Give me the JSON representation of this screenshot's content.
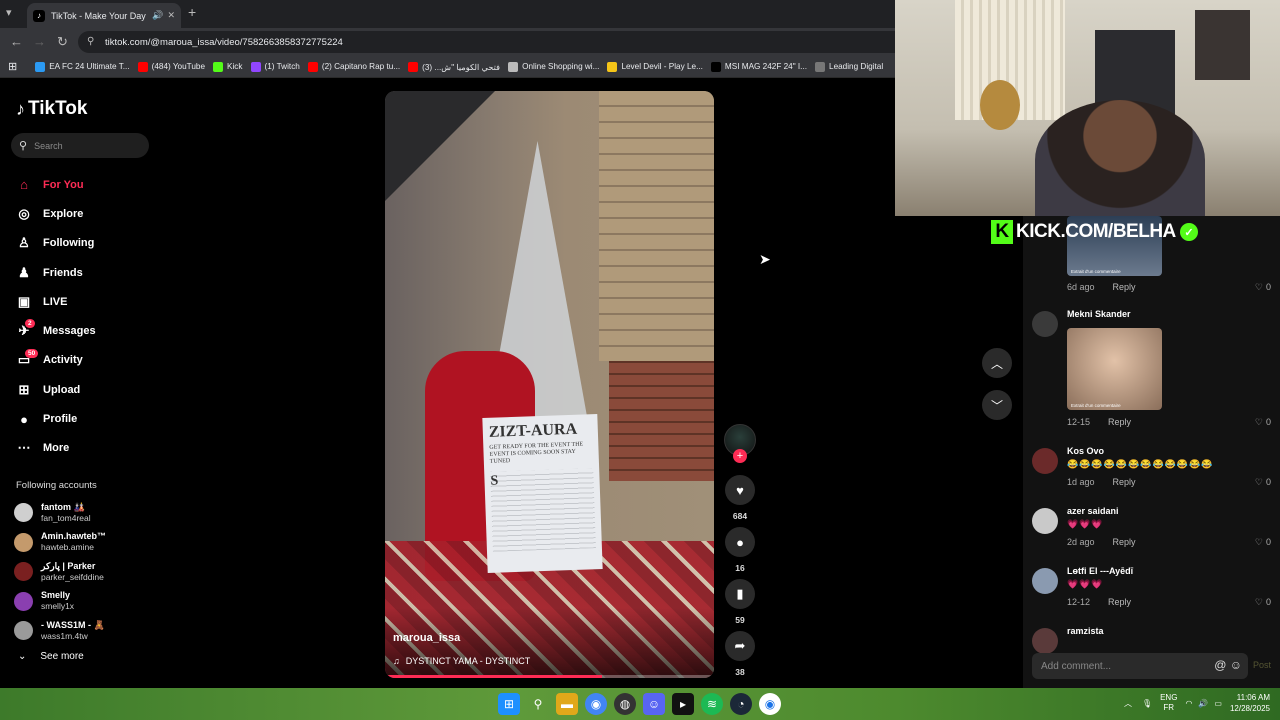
{
  "browser": {
    "tab_title": "TikTok - Make Your Day",
    "url": "tiktok.com/@maroua_issa/video/7582663858372775224",
    "bookmarks": [
      {
        "label": "EA FC 24 Ultimate T...",
        "color": "#2b9af3"
      },
      {
        "label": "(484) YouTube",
        "color": "#ff0000"
      },
      {
        "label": "Kick",
        "color": "#53fc18"
      },
      {
        "label": "(1) Twitch",
        "color": "#9146ff"
      },
      {
        "label": "(2) Capitano Rap tu...",
        "color": "#ff0000"
      },
      {
        "label": "فتحي الكوميا \"ش... (3)",
        "color": "#ff0000"
      },
      {
        "label": "Online Shopping wi...",
        "color": "#bbbbbb"
      },
      {
        "label": "Level Devil - Play Le...",
        "color": "#f5c518"
      },
      {
        "label": "MSI MAG 242F 24\" I...",
        "color": "#000000"
      },
      {
        "label": "Leading Digital",
        "color": "#777777"
      }
    ]
  },
  "tiktok": {
    "logo": "TikTok",
    "search_placeholder": "Search",
    "nav": [
      {
        "label": "For You",
        "icon": "home-icon",
        "glyph": "⌂",
        "active": true,
        "badge": ""
      },
      {
        "label": "Explore",
        "icon": "compass-icon",
        "glyph": "◎",
        "active": false,
        "badge": ""
      },
      {
        "label": "Following",
        "icon": "following-icon",
        "glyph": "♙",
        "active": false,
        "badge": ""
      },
      {
        "label": "Friends",
        "icon": "friends-icon",
        "glyph": "♟",
        "active": false,
        "badge": ""
      },
      {
        "label": "LIVE",
        "icon": "live-icon",
        "glyph": "▣",
        "active": false,
        "badge": ""
      },
      {
        "label": "Messages",
        "icon": "messages-icon",
        "glyph": "✈",
        "active": false,
        "badge": "2"
      },
      {
        "label": "Activity",
        "icon": "activity-icon",
        "glyph": "▭",
        "active": false,
        "badge": "50"
      },
      {
        "label": "Upload",
        "icon": "upload-icon",
        "glyph": "⊞",
        "active": false,
        "badge": ""
      },
      {
        "label": "Profile",
        "icon": "profile-icon",
        "glyph": "●",
        "active": false,
        "badge": ""
      },
      {
        "label": "More",
        "icon": "more-icon",
        "glyph": "⋯",
        "active": false,
        "badge": ""
      }
    ],
    "following_title": "Following accounts",
    "following": [
      {
        "name": "fantom 🎎",
        "handle": "fan_tom4real",
        "color": "#cfcfcf"
      },
      {
        "name": "Amin.hawteb™",
        "handle": "hawteb.amine",
        "color": "#c49a6c"
      },
      {
        "name": "پارکر | Parker",
        "handle": "parker_seifddine",
        "color": "#7a2020"
      },
      {
        "name": "Smelly",
        "handle": "smelly1x",
        "color": "#8a3fb0"
      },
      {
        "name": "- WASS1M - 🧸",
        "handle": "wass1m.4tw",
        "color": "#9a9a9a"
      }
    ],
    "see_more": "See more"
  },
  "video": {
    "username": "maroua_issa",
    "music": "DYSTINCT YAMA - DYSTINCT",
    "poster_heading": "ZIZT-AURA",
    "poster_text": "GET READY FOR THE EVENT THE EVENT IS COMING SOON STAY TUNED",
    "poster_letter": "S",
    "progress_fraction": 0.66,
    "likes": "684",
    "comments": "16",
    "saves": "59",
    "shares": "38"
  },
  "comments": [
    {
      "name": "",
      "text": "",
      "time": "6d ago",
      "likes": "0",
      "avatar": "",
      "has_thumb": true,
      "thumb_caption": "Extrait d'un commentaire"
    },
    {
      "name": "Mekni Skander",
      "text": "",
      "time": "12-15",
      "likes": "0",
      "avatar": "#3a3a3a",
      "has_thumb": true,
      "thumb_caption": "Extrait d'un commentaire"
    },
    {
      "name": "Kos Ovo",
      "text": "😂😂😂😂😂😂😂😂😂😂😂😂",
      "time": "1d ago",
      "likes": "0",
      "avatar": "#6b2a2a",
      "has_thumb": false
    },
    {
      "name": "azer saidani",
      "text": "💗💗💗",
      "time": "2d ago",
      "likes": "0",
      "avatar": "#c9c9c9",
      "has_thumb": false
    },
    {
      "name": "Lɵtfi El ---Ayēdī",
      "text": "💗💗💗",
      "time": "12-12",
      "likes": "0",
      "avatar": "#8a9ab0",
      "has_thumb": false
    },
    {
      "name": "ramzista",
      "text": "",
      "time": "",
      "likes": "",
      "avatar": "#5a3a3a",
      "has_thumb": false
    }
  ],
  "comment_ui": {
    "reply_label": "Reply",
    "add_placeholder": "Add comment...",
    "post_label": "Post"
  },
  "stream": {
    "channel": "KICK.COM/BELHA",
    "accent": "#53fc18"
  },
  "taskbar": {
    "lang_top": "ENG",
    "lang_bottom": "FR",
    "time": "11:06 AM",
    "date": "12/28/2025"
  }
}
